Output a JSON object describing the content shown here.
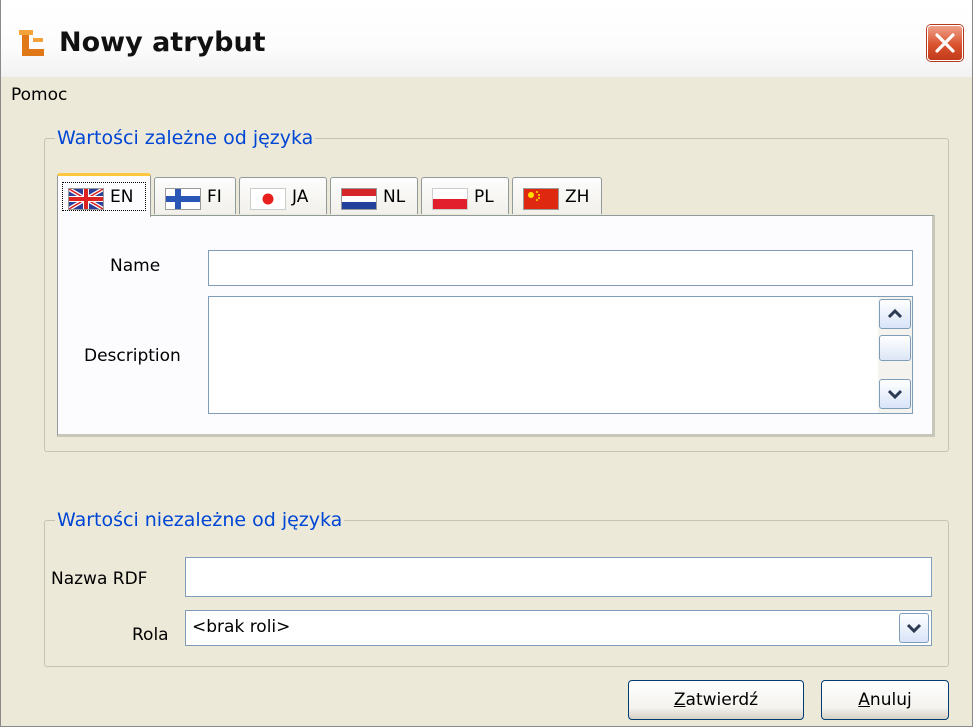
{
  "window": {
    "title": "Nowy atrybut",
    "icon": "app-logo-icon",
    "close_icon": "close-icon"
  },
  "menu": {
    "help": "Pomoc"
  },
  "language_group": {
    "legend": "Wartości zależne od języka",
    "tabs": [
      {
        "code": "EN",
        "flag": "uk-flag-icon",
        "active": true
      },
      {
        "code": "FI",
        "flag": "finland-flag-icon",
        "active": false
      },
      {
        "code": "JA",
        "flag": "japan-flag-icon",
        "active": false
      },
      {
        "code": "NL",
        "flag": "netherlands-flag-icon",
        "active": false
      },
      {
        "code": "PL",
        "flag": "poland-flag-icon",
        "active": false
      },
      {
        "code": "ZH",
        "flag": "china-flag-icon",
        "active": false
      }
    ],
    "name_label": "Name",
    "name_value": "",
    "description_label": "Description",
    "description_value": ""
  },
  "independent_group": {
    "legend": "Wartości niezależne od języka",
    "rdf_label": "Nazwa RDF",
    "rdf_value": "",
    "role_label": "Rola",
    "role_value": "<brak roli>"
  },
  "buttons": {
    "confirm_first": "Z",
    "confirm_rest": "atwierdź",
    "cancel_first": "A",
    "cancel_rest": "nuluj"
  },
  "colors": {
    "legend_text": "#0046d5",
    "window_bg": "#ece9d8",
    "close_button": "#d9532e",
    "active_tab_accent": "#ffc83c"
  }
}
